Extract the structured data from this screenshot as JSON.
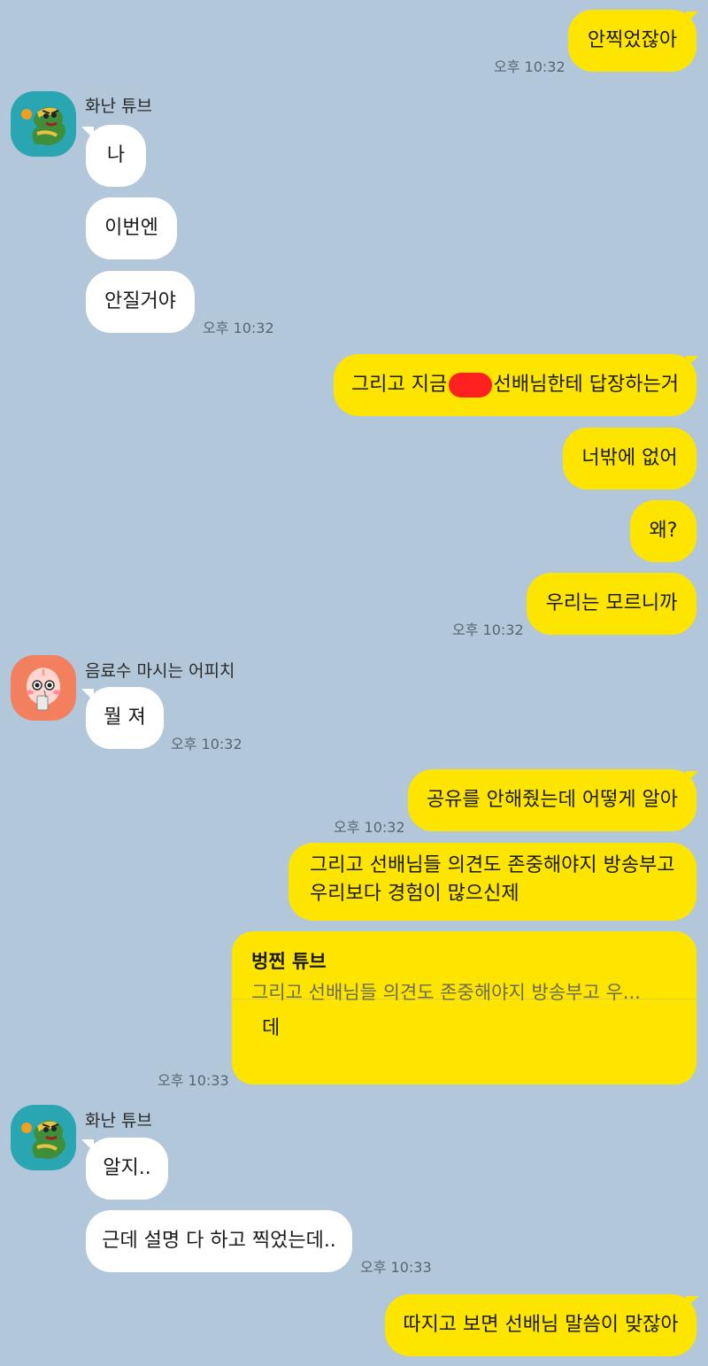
{
  "chat": {
    "messages": {
      "m1": {
        "text": "안찍었잖아",
        "time": "오후 10:32"
      },
      "s1": {
        "sender": "화난 튜브"
      },
      "m2": {
        "text": "나"
      },
      "m3": {
        "text": "이번엔"
      },
      "m4": {
        "text": "안질거야",
        "time": "오후 10:32"
      },
      "m5": {
        "before": "그리고 지금",
        "after": "선배님한테 답장하는거"
      },
      "m6": {
        "text": "너밖에 없어"
      },
      "m7": {
        "text": "왜?"
      },
      "m8": {
        "text": "우리는 모르니까",
        "time": "오후 10:32"
      },
      "s2": {
        "sender": "음료수 마시는 어피치"
      },
      "m9": {
        "text": "뭘 져",
        "time": "오후 10:32"
      },
      "m10": {
        "text": "공유를 안해줬는데 어떻게 알아",
        "time": "오후 10:32"
      },
      "m11": {
        "line1": "그리고 선배님들 의견도 존중해야지 방송부고",
        "line2": "우리보다 경험이 많으신제"
      },
      "m12": {
        "reply_name": "벙찐 튜브",
        "reply_quote": "그리고 선배님들 의견도 존중해야지 방송부고 우...",
        "text": "데",
        "time": "오후 10:33"
      },
      "s3": {
        "sender": "화난 튜브"
      },
      "m13": {
        "text": "알지.."
      },
      "m14": {
        "text": "근데 설명 다 하고 찍었는데..",
        "time": "오후 10:33"
      },
      "m15": {
        "text": "따지고 보면 선배님 말씀이 맞잖아"
      }
    }
  },
  "colors": {
    "background": "#b2c7d9",
    "my_bubble": "#fee500",
    "their_bubble": "#ffffff",
    "redaction": "#ff2020",
    "tube_avatar": "#2aa6b2",
    "apeach_avatar": "#f2805f"
  },
  "icons": {
    "tube_avatar": "angry-tube-avatar-icon",
    "apeach_avatar": "apeach-drinking-avatar-icon"
  }
}
